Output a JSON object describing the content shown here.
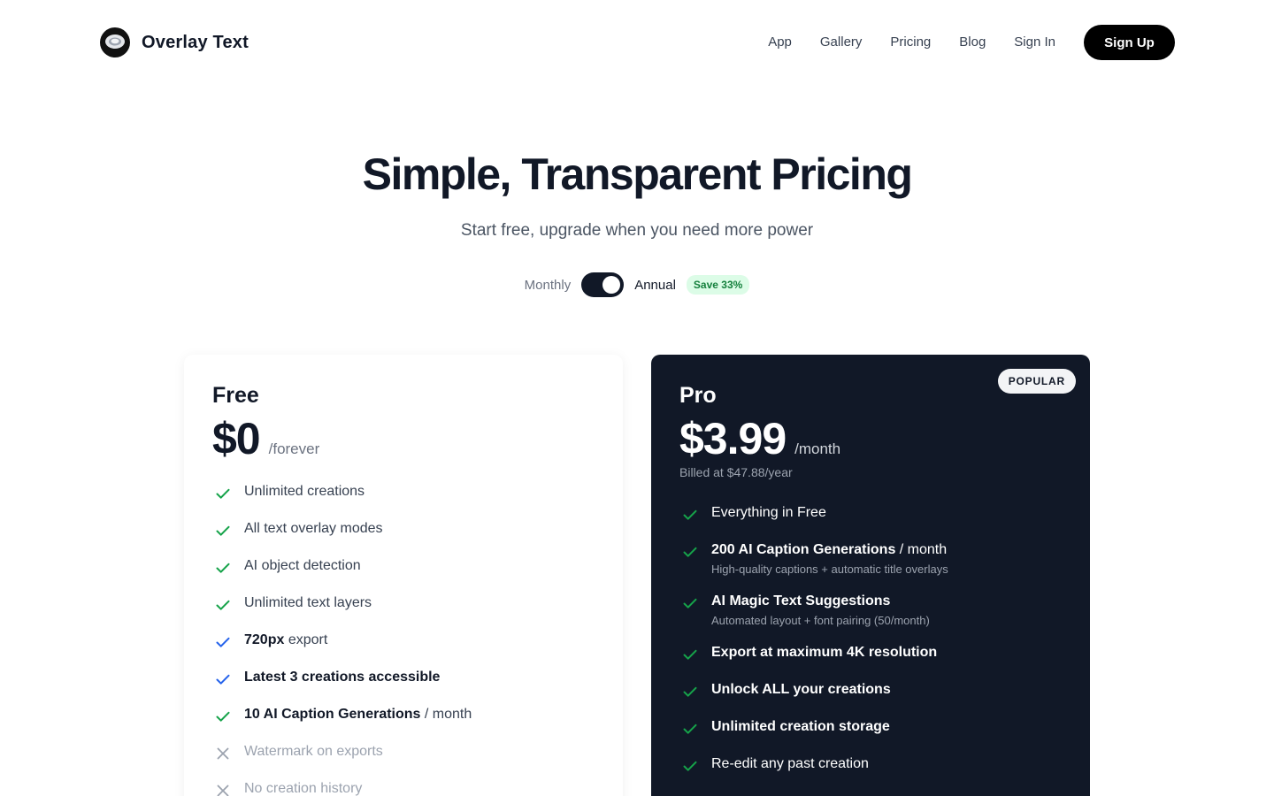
{
  "brand": {
    "name": "Overlay Text"
  },
  "nav": {
    "links": [
      "App",
      "Gallery",
      "Pricing",
      "Blog",
      "Sign In"
    ],
    "signup_label": "Sign Up"
  },
  "hero": {
    "title": "Simple, Transparent Pricing",
    "subtitle": "Start free, upgrade when you need more power"
  },
  "billing": {
    "monthly_label": "Monthly",
    "annual_label": "Annual",
    "selected": "Annual",
    "save_badge": "Save 33%"
  },
  "colors": {
    "check_green": "#16a34a",
    "check_blue": "#2563eb",
    "cross_gray": "#9ca3af",
    "pro_bg": "#111827"
  },
  "plans": {
    "free": {
      "name": "Free",
      "price": "$0",
      "period": "/forever",
      "features": [
        {
          "icon": "check-icon",
          "text": "Unlimited creations"
        },
        {
          "icon": "check-icon",
          "text": "All text overlay modes"
        },
        {
          "icon": "check-icon",
          "text": "AI object detection"
        },
        {
          "icon": "check-icon",
          "text": "Unlimited text layers"
        },
        {
          "icon": "check-blue-icon",
          "strong": "720px",
          "text": " export"
        },
        {
          "icon": "check-blue-icon",
          "strong": "Latest 3 creations accessible",
          "text": ""
        },
        {
          "icon": "check-icon",
          "strong": "10 AI Caption Generations",
          "text": " / month"
        },
        {
          "icon": "cross-icon",
          "text": "Watermark on exports"
        },
        {
          "icon": "cross-icon",
          "text": "No creation history"
        }
      ]
    },
    "pro": {
      "name": "Pro",
      "badge": "POPULAR",
      "price": "$3.99",
      "period": "/month",
      "billed_note": "Billed at $47.88/year",
      "features": [
        {
          "icon": "check-icon",
          "text": "Everything in Free"
        },
        {
          "icon": "check-icon",
          "strong": "200 AI Caption Generations",
          "text": " / month",
          "sub": "High-quality captions + automatic title overlays"
        },
        {
          "icon": "check-icon",
          "strong": "AI Magic Text Suggestions",
          "text": "",
          "sub": "Automated layout + font pairing (50/month)"
        },
        {
          "icon": "check-icon",
          "strong": "Export at maximum 4K resolution",
          "text": ""
        },
        {
          "icon": "check-icon",
          "strong": "Unlock ALL your creations",
          "text": ""
        },
        {
          "icon": "check-icon",
          "strong": "Unlimited creation storage",
          "text": ""
        },
        {
          "icon": "check-icon",
          "text": "Re-edit any past creation"
        },
        {
          "icon": "check-icon",
          "text": ""
        }
      ]
    }
  }
}
